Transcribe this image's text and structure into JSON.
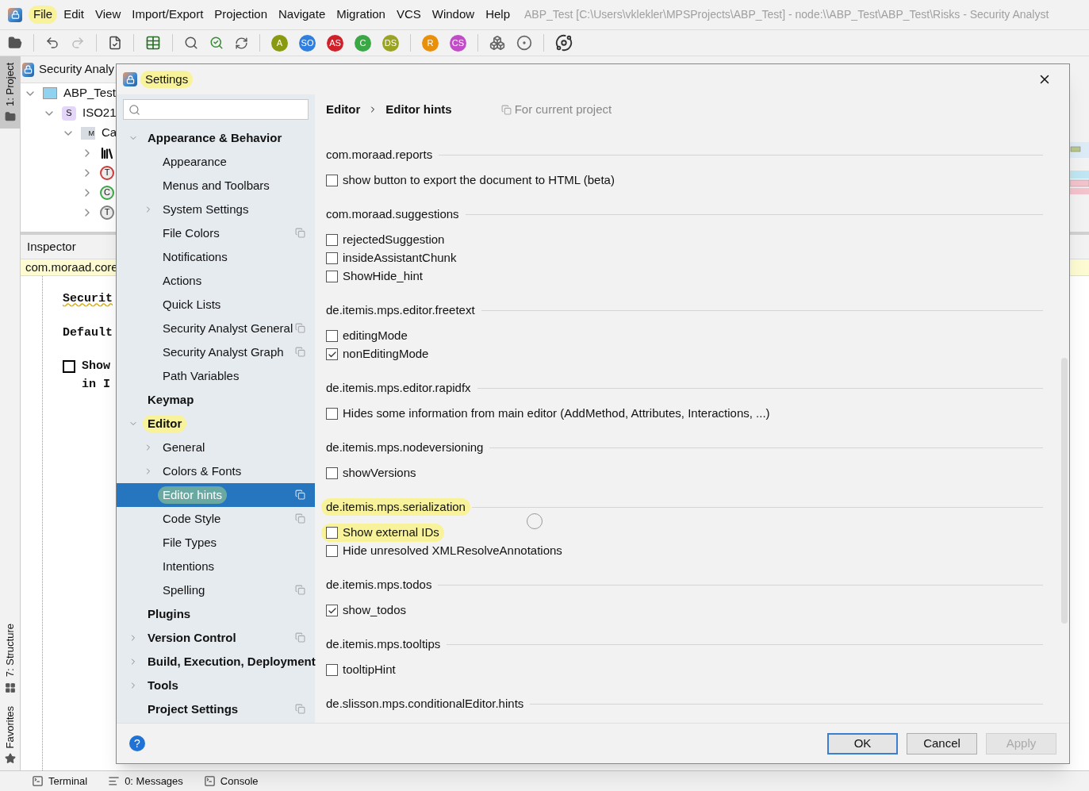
{
  "menu": [
    {
      "label": "File",
      "highlighted": true
    },
    {
      "label": "Edit",
      "highlighted": false
    },
    {
      "label": "View",
      "highlighted": false
    },
    {
      "label": "Import/Export",
      "highlighted": false
    },
    {
      "label": "Projection",
      "highlighted": false
    },
    {
      "label": "Navigate",
      "highlighted": false
    },
    {
      "label": "Migration",
      "highlighted": false
    },
    {
      "label": "VCS",
      "highlighted": false
    },
    {
      "label": "Window",
      "highlighted": false
    },
    {
      "label": "Help",
      "highlighted": false
    }
  ],
  "window_title": "ABP_Test [C:\\Users\\vklekler\\MPSProjects\\ABP_Test] - node:\\\\ABP_Test\\ABP_Test\\Risks - Security Analyst",
  "toolbar_badges": [
    {
      "label": "A",
      "color": "#8a9a10"
    },
    {
      "label": "SO",
      "color": "#2f7fe0"
    },
    {
      "label": "AS",
      "color": "#d0202a"
    },
    {
      "label": "C",
      "color": "#3aa845"
    },
    {
      "label": "DS",
      "color": "#9aa322"
    },
    {
      "label": "R",
      "color": "#e8900c"
    },
    {
      "label": "CS",
      "color": "#c34bc9"
    }
  ],
  "side_tabs": [
    {
      "label": "1: Project",
      "selected": true,
      "kind": "folder"
    },
    {
      "label": "7: Structure",
      "selected": false,
      "kind": "structure"
    },
    {
      "label": "Favorites",
      "selected": false,
      "kind": "star"
    }
  ],
  "project": {
    "title": "Security Analy",
    "tree": [
      {
        "label": "ABP_Test",
        "kind": "project",
        "expanded": true,
        "children": [
          {
            "label": "ISO21",
            "kind": "solution",
            "badge": "S",
            "expanded": true,
            "children": [
              {
                "label": "Ca",
                "kind": "model",
                "badge": "M",
                "expanded": true,
                "children": [
                  {
                    "kind": "library",
                    "expanded": false
                  },
                  {
                    "kind": "letter",
                    "badge": "T",
                    "color": "#d03a3a",
                    "expanded": false
                  },
                  {
                    "kind": "letter",
                    "badge": "C",
                    "color": "#3aa845",
                    "expanded": false
                  },
                  {
                    "kind": "letter",
                    "badge": "T",
                    "color": "#808080",
                    "expanded": false
                  }
                ]
              }
            ]
          }
        ]
      }
    ]
  },
  "inspector": {
    "title": "Inspector",
    "node": "com.moraad.core",
    "lines": [
      {
        "kind": "text",
        "text": "Securit",
        "warning": true
      },
      {
        "kind": "text",
        "text": "Default",
        "warning": false
      },
      {
        "kind": "checkbox",
        "text": "Show",
        "continuation": "in I",
        "checked": false,
        "warning": false
      }
    ]
  },
  "settings": {
    "title": "Settings",
    "title_highlighted": true,
    "nav": [
      {
        "label": "Appearance & Behavior",
        "expanded": true,
        "per_project": false,
        "selected": false,
        "highlighted": false,
        "children": [
          {
            "label": "Appearance",
            "per_project": false,
            "selected": false,
            "highlighted": false
          },
          {
            "label": "Menus and Toolbars",
            "per_project": false,
            "selected": false,
            "highlighted": false
          },
          {
            "label": "System Settings",
            "expanded": false,
            "per_project": false,
            "selected": false,
            "highlighted": false
          },
          {
            "label": "File Colors",
            "per_project": true,
            "selected": false,
            "highlighted": false
          },
          {
            "label": "Notifications",
            "per_project": false,
            "selected": false,
            "highlighted": false
          },
          {
            "label": "Actions",
            "per_project": false,
            "selected": false,
            "highlighted": false
          },
          {
            "label": "Quick Lists",
            "per_project": false,
            "selected": false,
            "highlighted": false
          },
          {
            "label": "Security Analyst General",
            "per_project": true,
            "selected": false,
            "highlighted": false
          },
          {
            "label": "Security Analyst Graph",
            "per_project": true,
            "selected": false,
            "highlighted": false
          },
          {
            "label": "Path Variables",
            "per_project": false,
            "selected": false,
            "highlighted": false
          }
        ]
      },
      {
        "label": "Keymap",
        "per_project": false,
        "selected": false,
        "highlighted": false
      },
      {
        "label": "Editor",
        "expanded": true,
        "per_project": false,
        "selected": false,
        "highlighted": true,
        "children": [
          {
            "label": "General",
            "expanded": false,
            "per_project": false,
            "selected": false,
            "highlighted": false
          },
          {
            "label": "Colors & Fonts",
            "expanded": false,
            "per_project": false,
            "selected": false,
            "highlighted": false
          },
          {
            "label": "Editor hints",
            "per_project": true,
            "selected": true,
            "highlighted": true
          },
          {
            "label": "Code Style",
            "per_project": true,
            "selected": false,
            "highlighted": false
          },
          {
            "label": "File Types",
            "per_project": false,
            "selected": false,
            "highlighted": false
          },
          {
            "label": "Intentions",
            "per_project": false,
            "selected": false,
            "highlighted": false
          },
          {
            "label": "Spelling",
            "per_project": true,
            "selected": false,
            "highlighted": false
          }
        ]
      },
      {
        "label": "Plugins",
        "per_project": false,
        "selected": false,
        "highlighted": false
      },
      {
        "label": "Version Control",
        "expanded": false,
        "per_project": true,
        "selected": false,
        "highlighted": false
      },
      {
        "label": "Build, Execution, Deployment",
        "expanded": false,
        "per_project": false,
        "selected": false,
        "highlighted": false
      },
      {
        "label": "Tools",
        "expanded": false,
        "per_project": false,
        "selected": false,
        "highlighted": false
      },
      {
        "label": "Project Settings",
        "per_project": true,
        "selected": false,
        "highlighted": false
      }
    ],
    "breadcrumb": [
      "Editor",
      "Editor hints"
    ],
    "scope": "For current project",
    "sections": [
      {
        "title": "com.moraad.reports",
        "highlighted": false,
        "options": [
          {
            "label": "show button to export the document to HTML (beta)",
            "checked": false,
            "highlighted": false
          }
        ]
      },
      {
        "title": "com.moraad.suggestions",
        "highlighted": false,
        "options": [
          {
            "label": "rejectedSuggestion",
            "checked": false,
            "highlighted": false
          },
          {
            "label": "insideAssistantChunk",
            "checked": false,
            "highlighted": false
          },
          {
            "label": "ShowHide_hint",
            "checked": false,
            "highlighted": false
          }
        ]
      },
      {
        "title": "de.itemis.mps.editor.freetext",
        "highlighted": false,
        "options": [
          {
            "label": "editingMode",
            "checked": false,
            "highlighted": false
          },
          {
            "label": "nonEditingMode",
            "checked": true,
            "highlighted": false
          }
        ]
      },
      {
        "title": "de.itemis.mps.editor.rapidfx",
        "highlighted": false,
        "options": [
          {
            "label": "Hides some information from main editor (AddMethod, Attributes, Interactions, ...)",
            "checked": false,
            "highlighted": false
          }
        ]
      },
      {
        "title": "de.itemis.mps.nodeversioning",
        "highlighted": false,
        "options": [
          {
            "label": "showVersions",
            "checked": false,
            "highlighted": false
          }
        ]
      },
      {
        "title": "de.itemis.mps.serialization",
        "highlighted": true,
        "options": [
          {
            "label": "Show external IDs",
            "checked": false,
            "highlighted": true
          },
          {
            "label": "Hide unresolved XMLResolveAnnotations",
            "checked": false,
            "highlighted": false
          }
        ]
      },
      {
        "title": "de.itemis.mps.todos",
        "highlighted": false,
        "options": [
          {
            "label": "show_todos",
            "checked": true,
            "highlighted": false
          }
        ]
      },
      {
        "title": "de.itemis.mps.tooltips",
        "highlighted": false,
        "options": [
          {
            "label": "tooltipHint",
            "checked": false,
            "highlighted": false
          }
        ]
      },
      {
        "title": "de.slisson.mps.conditionalEditor.hints",
        "highlighted": false
      }
    ],
    "help": "?",
    "buttons": [
      {
        "label": "OK",
        "kind": "default",
        "disabled": false
      },
      {
        "label": "Cancel",
        "kind": "normal",
        "disabled": false
      },
      {
        "label": "Apply",
        "kind": "normal",
        "disabled": true
      }
    ]
  },
  "bottom_tools": [
    {
      "label": "Terminal",
      "kind": "terminal"
    },
    {
      "label": "0: Messages",
      "kind": "messages"
    },
    {
      "label": "Console",
      "kind": "terminal"
    }
  ]
}
